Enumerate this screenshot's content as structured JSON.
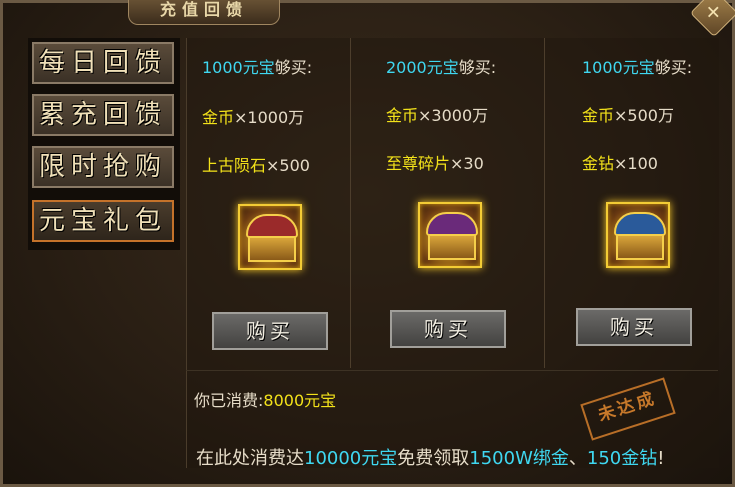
{
  "window": {
    "title": "充值回馈"
  },
  "sidebar": {
    "items": [
      {
        "label": "每日回馈",
        "active": false
      },
      {
        "label": "累充回馈",
        "active": false
      },
      {
        "label": "限时抢购",
        "active": false
      },
      {
        "label": "元宝礼包",
        "active": true
      }
    ]
  },
  "packs": [
    {
      "price": "1000元宝",
      "price_suffix": "够买:",
      "rewards": [
        {
          "name": "金币",
          "qty": "×1000万"
        },
        {
          "name": "上古陨石",
          "qty": "×500"
        }
      ],
      "chest_icon": "red-treasure-chest",
      "buy_label": "购买"
    },
    {
      "price": "2000元宝",
      "price_suffix": "够买:",
      "rewards": [
        {
          "name": "金币",
          "qty": "×3000万"
        },
        {
          "name": "至尊碎片",
          "qty": "×30"
        }
      ],
      "chest_icon": "purple-treasure-chest",
      "buy_label": "购买"
    },
    {
      "price": "1000元宝",
      "price_suffix": "够买:",
      "rewards": [
        {
          "name": "金币",
          "qty": "×500万"
        },
        {
          "name": "金钻",
          "qty": "×100"
        }
      ],
      "chest_icon": "blue-treasure-chest",
      "buy_label": "购买"
    }
  ],
  "spent": {
    "label": "你已消费:",
    "value": "8000元宝"
  },
  "stamp": {
    "label": "未达成"
  },
  "footer": {
    "prefix": "在此处消费达",
    "threshold": "10000元宝",
    "middle": "免费领取",
    "reward1": "1500W绑金",
    "sep": "、",
    "reward2": "150金钻",
    "suffix": "!"
  },
  "colors": {
    "cyan": "#3fd7f0",
    "yellow": "#f3e21a",
    "accent": "#c4722a"
  }
}
